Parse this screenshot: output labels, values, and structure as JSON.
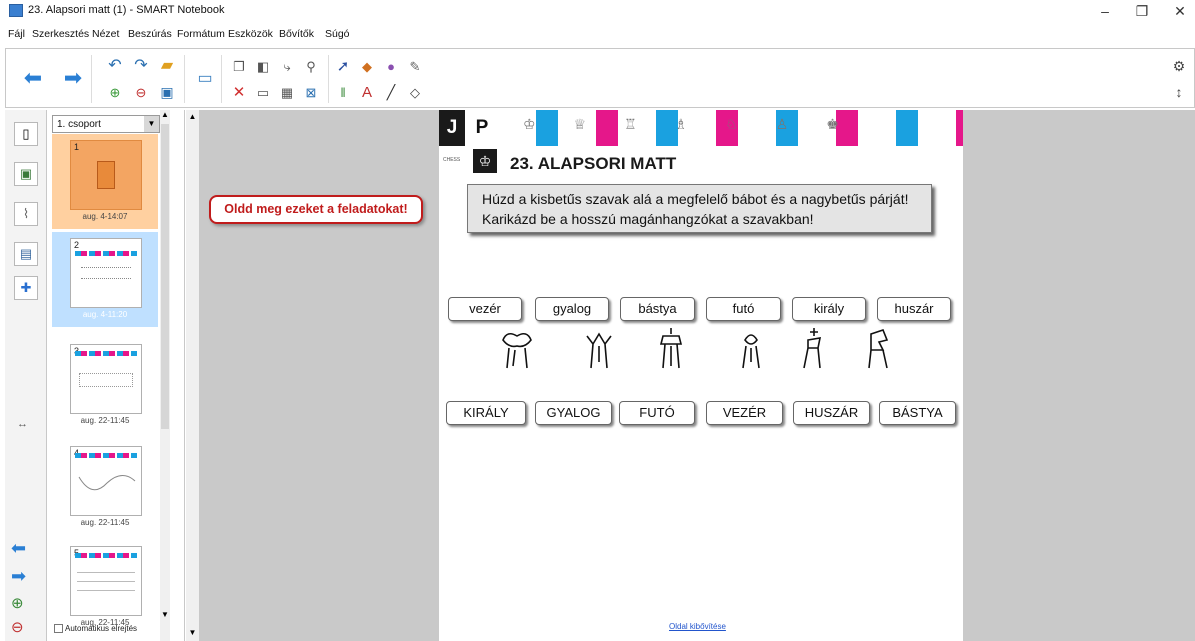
{
  "window": {
    "title": "23. Alapsori matt (1) - SMART Notebook",
    "minimize_label": "–",
    "restore_label": "❐",
    "close_label": "✕"
  },
  "menu": [
    "Fájl",
    "Szerkesztés",
    "Nézet",
    "Beszúrás",
    "Formátum",
    "Eszközök",
    "Bővítők",
    "Súgó"
  ],
  "sorter": {
    "group": "1. csoport",
    "pages": [
      {
        "num": "1",
        "date": "aug. 4-14:07"
      },
      {
        "num": "2",
        "date": "aug. 4-11:20"
      },
      {
        "num": "3",
        "date": "aug. 22-11:45"
      },
      {
        "num": "4",
        "date": "aug. 22-11:45"
      },
      {
        "num": "5",
        "date": "aug. 22-11:45"
      }
    ],
    "autohide_label": "Automatikus elrejtés"
  },
  "workspace": {
    "callout": "Oldd meg ezeket a feladatokat!",
    "footer_link": "Oldal kibővítése"
  },
  "page": {
    "header_letters": [
      "J",
      "P"
    ],
    "chess_small": "CHESS",
    "title": "23. ALAPSORI MATT",
    "task_line1": "Húzd a kisbetűs szavak alá a megfelelő bábot és a nagybetűs párját!",
    "task_line2": "Karikázd be a hosszú magánhangzókat a szavakban!",
    "lower_words": [
      "vezér",
      "gyalog",
      "bástya",
      "futó",
      "király",
      "huszár"
    ],
    "upper_words": [
      "KIRÁLY",
      "GYALOG",
      "FUTÓ",
      "VEZÉR",
      "HUSZÁR",
      "BÁSTYA"
    ],
    "strip_colors": [
      "#1aa1e0",
      "#e5178a",
      "#1aa1e0",
      "#9dc43a",
      "#1aa1e0",
      "#e5178a",
      "#1aa1e0",
      "#f08a1c"
    ]
  },
  "colors": {
    "accent_blue": "#2a7fd4",
    "callout_red": "#c01c1c",
    "selected_thumb": "#bfe0ff"
  }
}
